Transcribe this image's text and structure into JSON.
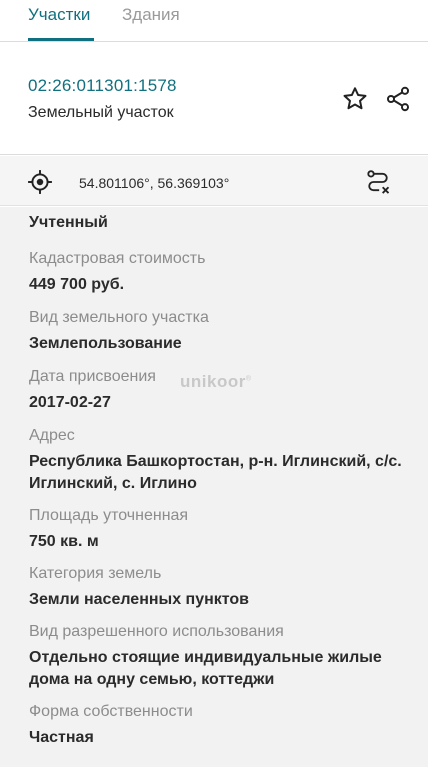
{
  "tabs": [
    {
      "label": "Участки",
      "active": true
    },
    {
      "label": "Здания",
      "active": false
    }
  ],
  "header": {
    "cadastral_number": "02:26:011301:1578",
    "parcel_type": "Земельный участок"
  },
  "icons": {
    "favorite": "star-outline-icon",
    "share": "share-icon",
    "location": "crosshair-location-icon",
    "route": "route-icon"
  },
  "coordinates": "54.801106°, 56.369103°",
  "status": "Учтенный",
  "fields": [
    {
      "label": "Кадастровая стоимость",
      "value": "449 700 руб."
    },
    {
      "label": "Вид земельного участка",
      "value": "Землепользование"
    },
    {
      "label": "Дата присвоения",
      "value": "2017-02-27"
    },
    {
      "label": "Адрес",
      "value": "Республика Башкортостан, р-н. Иглинский, с/с. Иглинский, с. Иглино"
    },
    {
      "label": "Площадь уточненная",
      "value": "750 кв. м"
    },
    {
      "label": "Категория земель",
      "value": "Земли населенных пунктов"
    },
    {
      "label": "Вид разрешенного использования",
      "value": "Отдельно стоящие индивидуальные жилые дома на одну семью, коттеджи"
    },
    {
      "label": "Форма собственности",
      "value": "Частная"
    }
  ],
  "watermark": {
    "text": "unikoor",
    "mark": "®"
  },
  "colors": {
    "accent": "#11707f",
    "label": "#8c8c8c",
    "value": "#2b2b2b",
    "background": "#f2f2f2"
  }
}
